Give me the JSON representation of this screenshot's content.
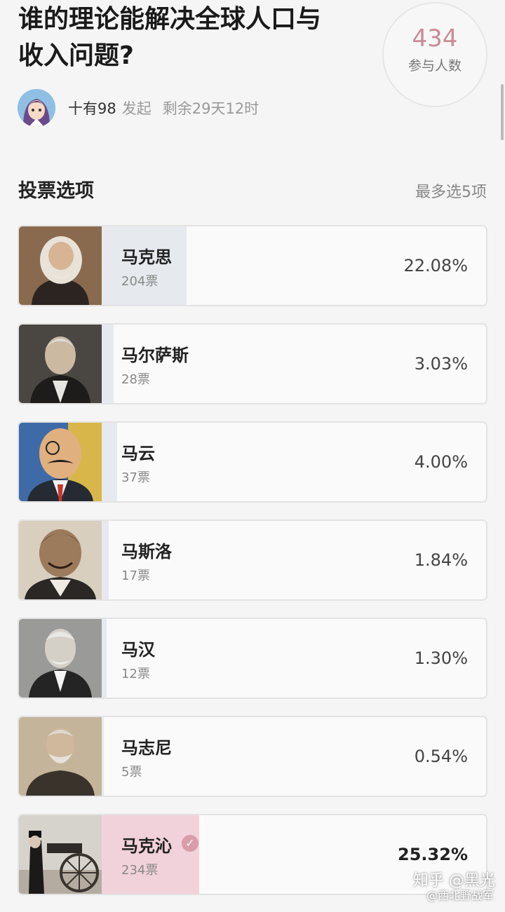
{
  "poll": {
    "title": "谁的理论能解决全球人口与\n收入问题?",
    "participants_count": "434",
    "participants_label": "参与人数",
    "author": "十有98",
    "author_action": "发起",
    "remaining": "剩余29天12时",
    "section_title": "投票选项",
    "max_select": "最多选5项"
  },
  "options": [
    {
      "name": "马克思",
      "votes": "204票",
      "percent": "22.08%",
      "share": 0.2208,
      "selected": false
    },
    {
      "name": "马尔萨斯",
      "votes": "28票",
      "percent": "3.03%",
      "share": 0.0303,
      "selected": false
    },
    {
      "name": "马云",
      "votes": "37票",
      "percent": "4.00%",
      "share": 0.04,
      "selected": false
    },
    {
      "name": "马斯洛",
      "votes": "17票",
      "percent": "1.84%",
      "share": 0.0184,
      "selected": false
    },
    {
      "name": "马汉",
      "votes": "12票",
      "percent": "1.30%",
      "share": 0.013,
      "selected": false
    },
    {
      "name": "马志尼",
      "votes": "5票",
      "percent": "0.54%",
      "share": 0.0054,
      "selected": false
    },
    {
      "name": "马克沁",
      "votes": "234票",
      "percent": "25.32%",
      "share": 0.2532,
      "selected": true
    }
  ],
  "watermark": {
    "line1": "知乎 @黑光",
    "line2": "@西北野战军"
  },
  "colors": {
    "accent": "#c98b97",
    "fill": "#e6e9ee",
    "fill_selected": "#f2d2da"
  }
}
